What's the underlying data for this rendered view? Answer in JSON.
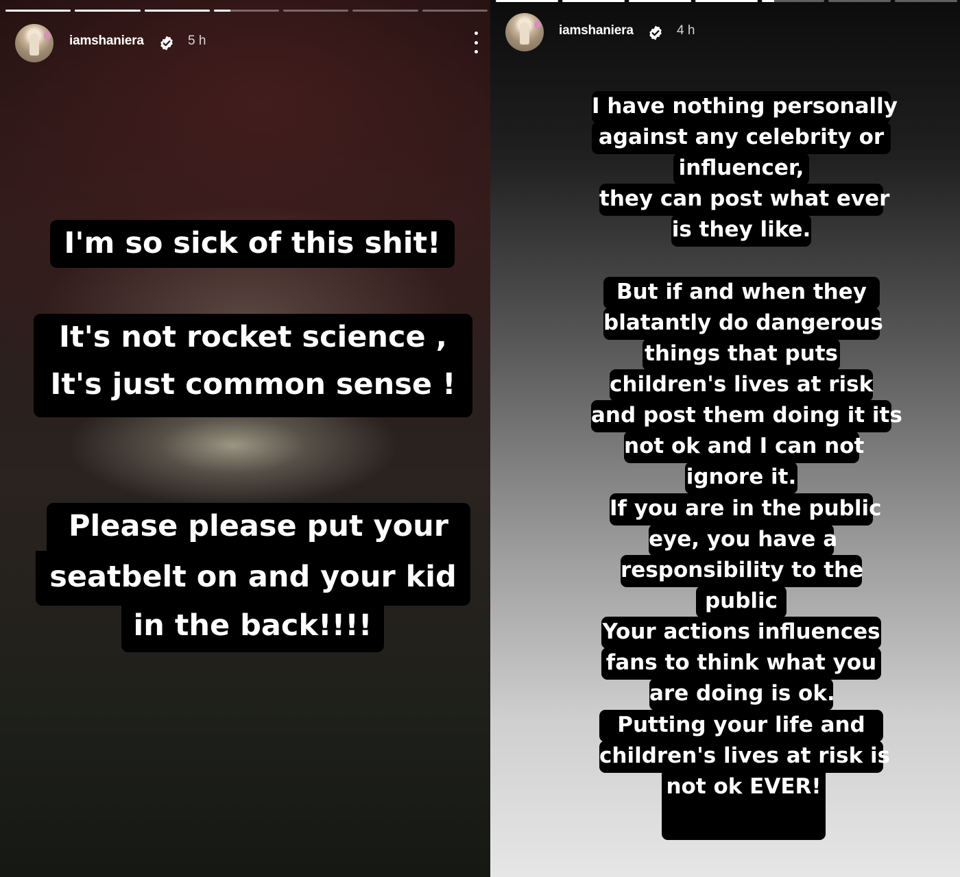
{
  "stories": [
    {
      "username": "iamshaniera",
      "time": "5 h",
      "progress": [
        1,
        1,
        1,
        0.25,
        0,
        0,
        0
      ],
      "icons": {
        "verified": "verified-badge-icon",
        "menu": "more-options-icon"
      },
      "lines": [
        "I'm so sick of this shit!",
        "It's not rocket science ,",
        "It's just common sense !",
        "Please please put your",
        "seatbelt on and your kid",
        "in the back!!!!"
      ]
    },
    {
      "username": "iamshaniera",
      "time": "4 h",
      "progress": [
        1,
        1,
        1,
        1,
        0.2,
        0,
        0
      ],
      "icons": {
        "verified": "verified-badge-icon"
      },
      "lines": [
        "I have nothing personally",
        "against any celebrity or",
        "influencer,",
        "they can post what ever",
        "is they like.",
        "But if and when they",
        "blatantly do dangerous",
        "things that puts",
        "children's lives at risk",
        "and post them doing it its",
        "not ok and I can not",
        "ignore it.",
        "If you are in the public",
        "eye, you have a",
        "responsibility to the",
        "public",
        "Your actions influences",
        "fans to think what you",
        "are doing is ok.",
        "Putting your life and",
        "children's lives at risk is",
        "not ok EVER!"
      ]
    }
  ]
}
